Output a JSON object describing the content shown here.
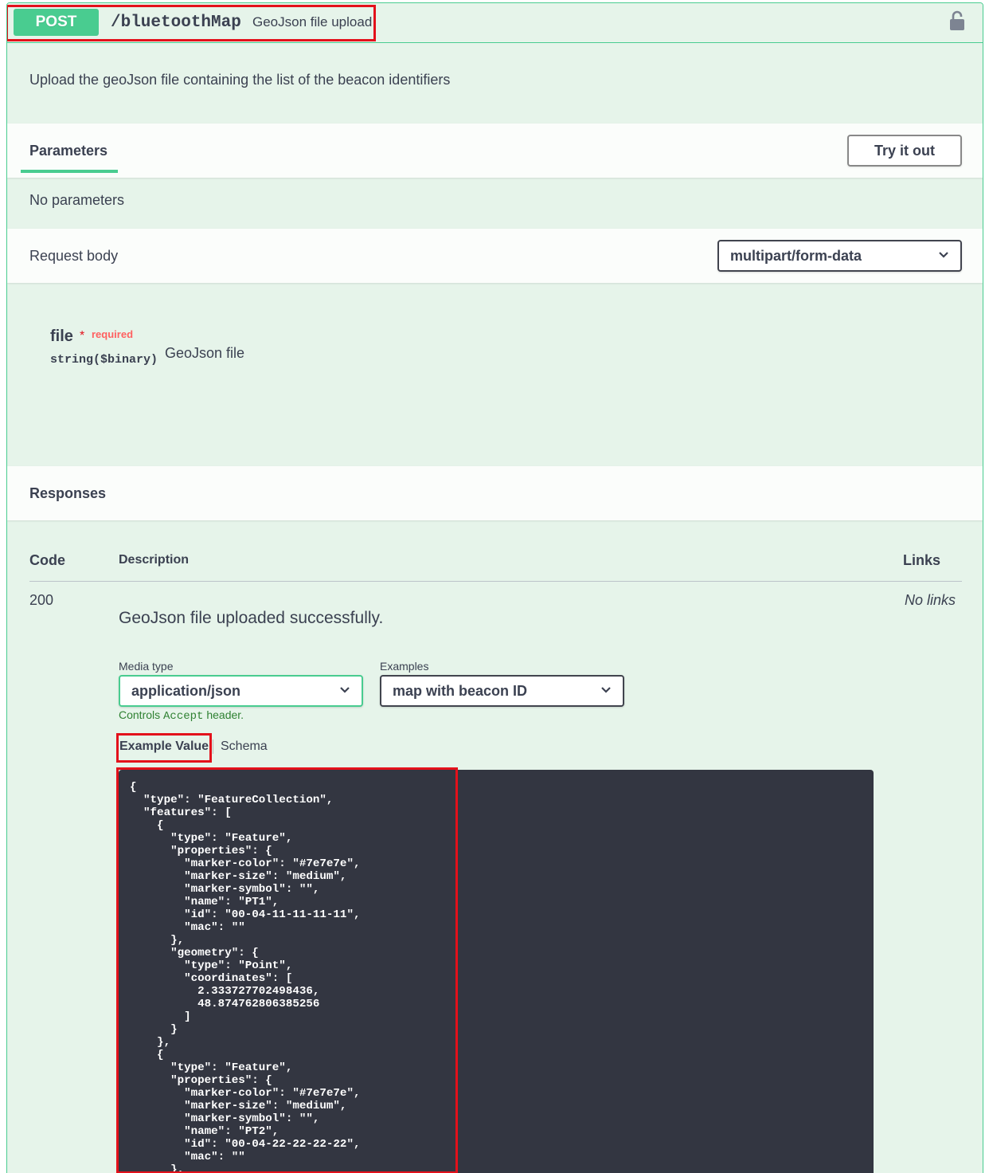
{
  "summary": {
    "method": "POST",
    "path": "/bluetoothMap",
    "description": "GeoJson file upload"
  },
  "operation_description": "Upload the geoJson file containing the list of the beacon identifiers",
  "parameters": {
    "title": "Parameters",
    "try_it_out": "Try it out",
    "empty_text": "No parameters"
  },
  "request_body": {
    "title": "Request body",
    "content_type": "multipart/form-data",
    "field": {
      "name": "file",
      "required_star": "*",
      "required_label": "required",
      "type": "string($binary)",
      "description": "GeoJson file"
    }
  },
  "responses": {
    "title": "Responses",
    "columns": {
      "code": "Code",
      "description": "Description",
      "links": "Links"
    },
    "rows": [
      {
        "code": "200",
        "description": "GeoJson file uploaded successfully.",
        "links": "No links",
        "media_type_label": "Media type",
        "media_type": "application/json",
        "examples_label": "Examples",
        "example": "map with beacon ID",
        "controls_prefix": "Controls",
        "controls_mono": "Accept",
        "controls_suffix": "header.",
        "tab_example": "Example Value",
        "tab_schema": "Schema",
        "example_json": "{\n  \"type\": \"FeatureCollection\",\n  \"features\": [\n    {\n      \"type\": \"Feature\",\n      \"properties\": {\n        \"marker-color\": \"#7e7e7e\",\n        \"marker-size\": \"medium\",\n        \"marker-symbol\": \"\",\n        \"name\": \"PT1\",\n        \"id\": \"00-04-11-11-11-11\",\n        \"mac\": \"\"\n      },\n      \"geometry\": {\n        \"type\": \"Point\",\n        \"coordinates\": [\n          2.333727702498436,\n          48.874762806385256\n        ]\n      }\n    },\n    {\n      \"type\": \"Feature\",\n      \"properties\": {\n        \"marker-color\": \"#7e7e7e\",\n        \"marker-size\": \"medium\",\n        \"marker-symbol\": \"\",\n        \"name\": \"PT2\",\n        \"id\": \"00-04-22-22-22-22\",\n        \"mac\": \"\"\n      },"
      }
    ]
  },
  "colors": {
    "post_green": "#49cc90",
    "block_background": "#e6f4ea",
    "highlight_red": "#e3111b",
    "code_background": "#333641",
    "required_red": "#ff6060"
  },
  "icons": {
    "lock": "lock-icon",
    "chevron": "chevron-down-icon"
  }
}
